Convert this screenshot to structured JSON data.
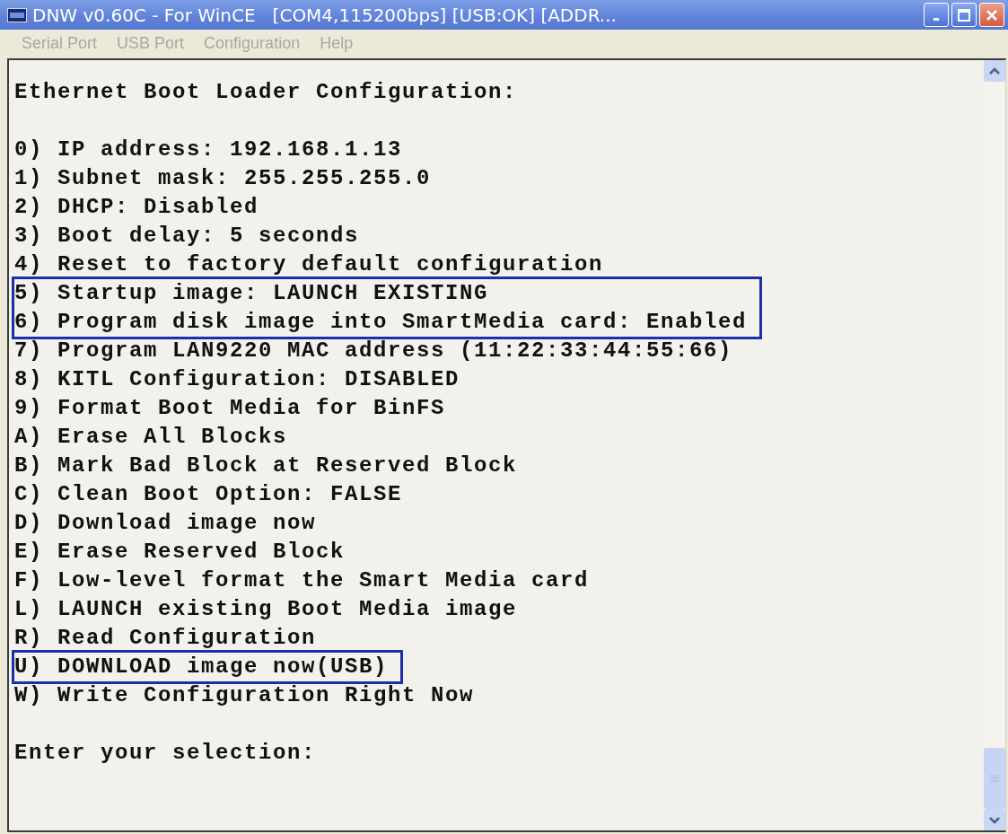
{
  "window": {
    "title": "DNW v0.60C - For WinCE   [COM4,115200bps] [USB:OK] [ADDR..."
  },
  "menu": [
    {
      "label": "Serial Port",
      "disabled": true
    },
    {
      "label": "USB Port",
      "disabled": true
    },
    {
      "label": "Configuration",
      "disabled": true
    },
    {
      "label": "Help",
      "disabled": true
    }
  ],
  "terminal": {
    "heading": "Ethernet Boot Loader Configuration:",
    "options": [
      {
        "text": "0) IP address: 192.168.1.13",
        "highlighted": false
      },
      {
        "text": "1) Subnet mask: 255.255.255.0",
        "highlighted": false
      },
      {
        "text": "2) DHCP: Disabled",
        "highlighted": false
      },
      {
        "text": "3) Boot delay: 5 seconds",
        "highlighted": false
      },
      {
        "text": "4) Reset to factory default configuration",
        "highlighted": false
      },
      {
        "text": "5) Startup image: LAUNCH EXISTING",
        "highlighted": true
      },
      {
        "text": "6) Program disk image into SmartMedia card: Enabled",
        "highlighted": true
      },
      {
        "text": "7) Program LAN9220 MAC address (11:22:33:44:55:66)",
        "highlighted": false
      },
      {
        "text": "8) KITL Configuration: DISABLED",
        "highlighted": false
      },
      {
        "text": "9) Format Boot Media for BinFS",
        "highlighted": false
      },
      {
        "text": "A) Erase All Blocks",
        "highlighted": false
      },
      {
        "text": "B) Mark Bad Block at Reserved Block",
        "highlighted": false
      },
      {
        "text": "C) Clean Boot Option: FALSE",
        "highlighted": false
      },
      {
        "text": "D) Download image now",
        "highlighted": false
      },
      {
        "text": "E) Erase Reserved Block",
        "highlighted": false
      },
      {
        "text": "F) Low-level format the Smart Media card",
        "highlighted": false
      },
      {
        "text": "L) LAUNCH existing Boot Media image",
        "highlighted": false
      },
      {
        "text": "R) Read Configuration",
        "highlighted": false
      },
      {
        "text": "U) DOWNLOAD image now(USB)",
        "highlighted": true
      },
      {
        "text": "W) Write Configuration Right Now",
        "highlighted": false
      }
    ],
    "prompt": "Enter your selection:"
  }
}
